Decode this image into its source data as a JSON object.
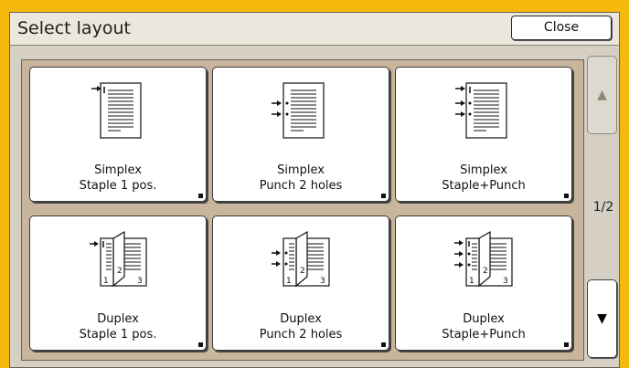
{
  "title": "Select layout",
  "close_label": "Close",
  "tiles": [
    {
      "line1": "Simplex",
      "line2": "Staple 1 pos."
    },
    {
      "line1": "Simplex",
      "line2": "Punch 2 holes"
    },
    {
      "line1": "Simplex",
      "line2": "Staple+Punch"
    },
    {
      "line1": "Duplex",
      "line2": "Staple 1 pos."
    },
    {
      "line1": "Duplex",
      "line2": "Punch 2 holes"
    },
    {
      "line1": "Duplex",
      "line2": "Staple+Punch"
    }
  ],
  "pager": {
    "page_indicator": "1/2",
    "up_glyph": "▲",
    "down_glyph": "▼"
  },
  "icons": [
    "simplex-staple-icon",
    "simplex-punch-icon",
    "simplex-staple-punch-icon",
    "duplex-staple-icon",
    "duplex-punch-icon",
    "duplex-staple-punch-icon"
  ]
}
